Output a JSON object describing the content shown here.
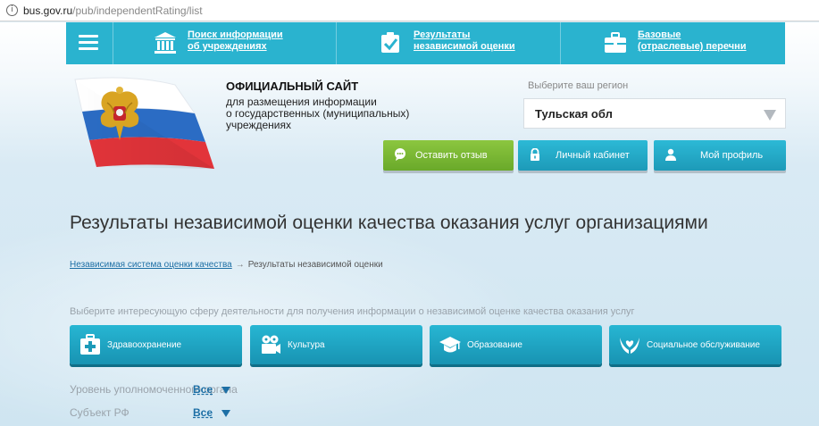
{
  "browser": {
    "url_host": "bus.gov.ru",
    "url_path": "/pub/independentRating/list",
    "info_icon": "info-icon"
  },
  "topnav": {
    "items": [
      {
        "label_line1": "Поиск информации",
        "label_line2": "об учреждениях",
        "icon": "building-icon"
      },
      {
        "label_line1": "Результаты",
        "label_line2": "независимой оценки",
        "icon": "checkbox-icon"
      },
      {
        "label_line1": "Базовые",
        "label_line2": "(отраслевые) перечни",
        "icon": "briefcase-icon"
      }
    ],
    "menu_icon": "hamburger-icon"
  },
  "header": {
    "title": "ОФИЦИАЛЬНЫЙ САЙТ",
    "desc_line1": "для размещения информации",
    "desc_line2": "о государственных (муниципальных)",
    "desc_line3": "учреждениях",
    "region_label": "Выберите ваш регион",
    "region_value": "Тульская обл",
    "buttons": {
      "feedback": "Оставить отзыв",
      "cabinet": "Личный кабинет",
      "profile": "Мой профиль"
    },
    "colors": {
      "nav": "#2ab3cf",
      "green": "#7bb834",
      "teal": "#24a8c6"
    }
  },
  "main": {
    "title": "Результаты независимой оценки качества оказания услуг организациями",
    "breadcrumb": {
      "link": "Независимая система оценки качества",
      "current": "Результаты независимой оценки"
    },
    "sphere_hint": "Выберите интересующую сферу деятельности для получения информации о независимой оценке качества оказания услуг",
    "spheres": [
      {
        "label": "Здравоохранение",
        "icon": "medical-kit-icon"
      },
      {
        "label": "Культура",
        "icon": "film-camera-icon"
      },
      {
        "label": "Образование",
        "icon": "graduation-cap-icon"
      },
      {
        "label": "Социальное обслуживание",
        "icon": "caring-hands-icon"
      }
    ],
    "filters": [
      {
        "label": "Уровень уполномоченного органа",
        "value": "Все"
      },
      {
        "label": "Субъект РФ",
        "value": "Все"
      }
    ]
  }
}
